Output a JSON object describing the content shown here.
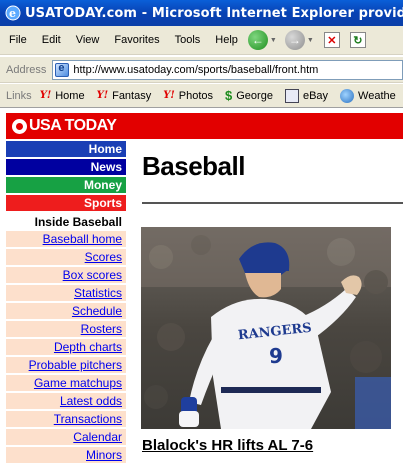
{
  "window": {
    "title": "USATODAY.com - Microsoft Internet Explorer provided by Com"
  },
  "menubar": {
    "items": [
      "File",
      "Edit",
      "View",
      "Favorites",
      "Tools",
      "Help"
    ]
  },
  "address": {
    "label": "Address",
    "url": "http://www.usatoday.com/sports/baseball/front.htm"
  },
  "links": {
    "label": "Links",
    "items": [
      {
        "label": "Home",
        "icon": "yahoo-icon"
      },
      {
        "label": "Fantasy",
        "icon": "yahoo-icon"
      },
      {
        "label": "Photos",
        "icon": "yahoo-icon"
      },
      {
        "label": "George",
        "icon": "dollar-icon"
      },
      {
        "label": "eBay",
        "icon": "ebay-icon"
      },
      {
        "label": "Weathe",
        "icon": "weather-icon"
      }
    ]
  },
  "site": {
    "logo": "USA TODAY",
    "brand_color": "#e20000"
  },
  "nav": {
    "sections": [
      {
        "label": "Home",
        "color": "#1a3fb5"
      },
      {
        "label": "News",
        "color": "#0000a0"
      },
      {
        "label": "Money",
        "color": "#17a144"
      },
      {
        "label": "Sports",
        "color": "#ee1d1d"
      }
    ],
    "subhead": "Inside Baseball",
    "links": [
      "Baseball home",
      "Scores",
      "Box scores",
      "Statistics",
      "Schedule",
      "Rosters",
      "Depth charts",
      "Probable pitchers",
      "Game matchups",
      "Latest odds",
      "Transactions",
      "Calendar",
      "Minors"
    ]
  },
  "main": {
    "title": "Baseball",
    "photo": {
      "jersey_text": "RANGERS",
      "jersey_number": "9"
    },
    "headline": "Blalock's HR lifts AL 7-6"
  }
}
